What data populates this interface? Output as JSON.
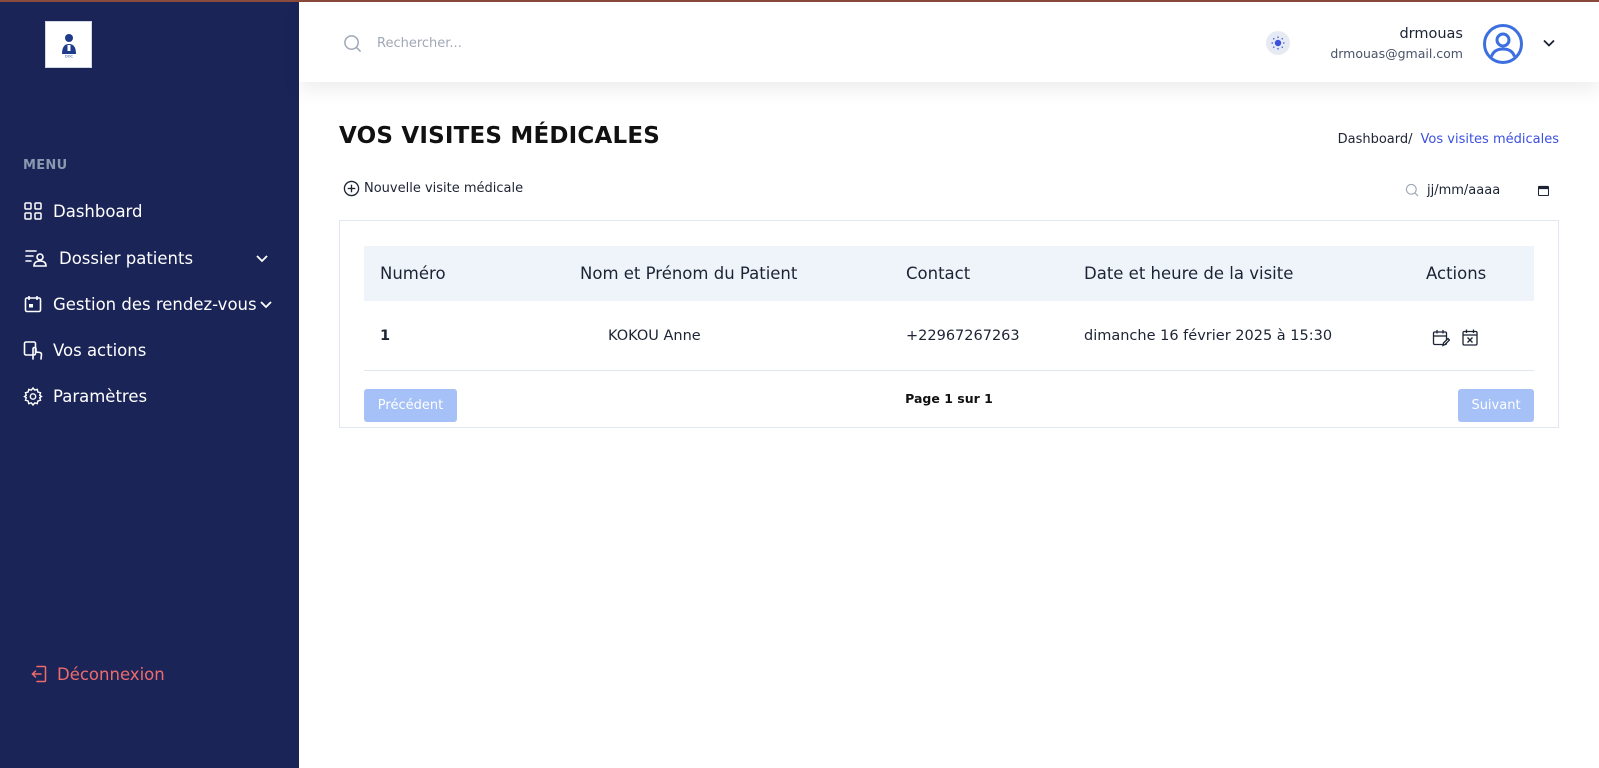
{
  "sidebar": {
    "menu_title": "MENU",
    "items": [
      {
        "label": "Dashboard",
        "icon": "grid-icon"
      },
      {
        "label": "Dossier patients",
        "icon": "user-list-icon",
        "has_submenu": true
      },
      {
        "label": "Gestion des rendez-vous",
        "icon": "calendar-icon",
        "has_submenu": true
      },
      {
        "label": "Vos actions",
        "icon": "touch-icon"
      },
      {
        "label": "Paramètres",
        "icon": "gear-icon"
      }
    ],
    "logout_label": "Déconnexion"
  },
  "header": {
    "search_placeholder": "Rechercher...",
    "user_name": "drmouas",
    "user_email": "drmouas@gmail.com"
  },
  "page": {
    "title": "VOS VISITES MÉDICALES",
    "breadcrumb": {
      "home": "Dashboard/",
      "current": "Vos visites médicales"
    },
    "new_visit_label": "Nouvelle visite médicale",
    "date_placeholder": "jj/mm/aaaa"
  },
  "table": {
    "columns": [
      "Numéro",
      "Nom et Prénom du Patient",
      "Contact",
      "Date et heure de la visite",
      "Actions"
    ],
    "rows": [
      {
        "numero": "1",
        "patient": "KOKOU Anne",
        "contact": "+22967267263",
        "date": "dimanche 16 février 2025 à 15:30"
      }
    ]
  },
  "pagination": {
    "prev_label": "Précédent",
    "next_label": "Suivant",
    "info": "Page 1 sur 1"
  },
  "colors": {
    "sidebar_bg": "#1a2457",
    "accent": "#3c50e0",
    "logout": "#ef6b6b",
    "disabled_button": "#a5c1f7"
  }
}
